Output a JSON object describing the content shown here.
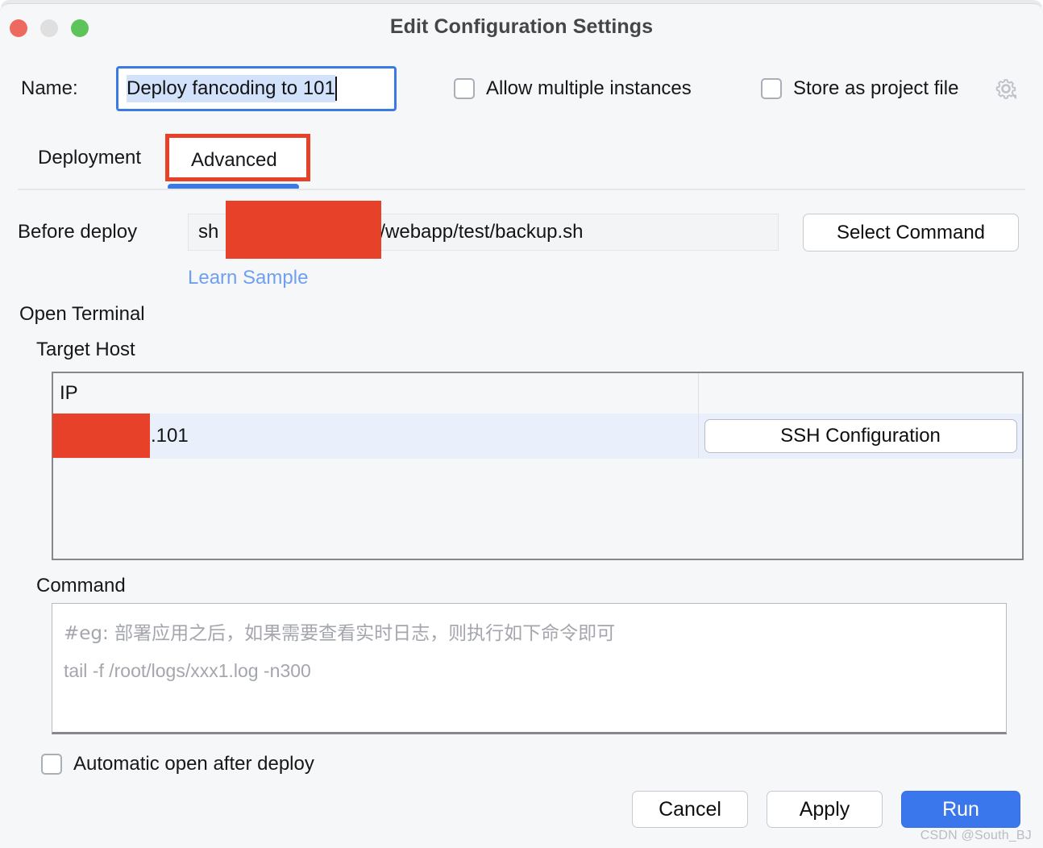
{
  "window": {
    "title": "Edit Configuration Settings",
    "traffic_lights": [
      "close-button",
      "minimize-button",
      "maximize-button"
    ]
  },
  "name_row": {
    "label": "Name:",
    "value": "Deploy fancoding to 101",
    "allow_multiple": {
      "label": "Allow multiple instances",
      "checked": false
    },
    "store_project_file": {
      "label": "Store as project file",
      "checked": false
    },
    "gear_icon": "gear-icon"
  },
  "tabs": [
    {
      "label": "Deployment",
      "active": false
    },
    {
      "label": "Advanced",
      "active": true
    }
  ],
  "before_deploy": {
    "label": "Before deploy",
    "value_prefix": "sh",
    "value_suffix": "/webapp/test/backup.sh",
    "redacted": true,
    "select_command_label": "Select Command",
    "learn_link": "Learn Sample"
  },
  "open_terminal": {
    "label": "Open Terminal",
    "target_host_label": "Target Host",
    "table": {
      "columns": [
        "IP",
        ""
      ],
      "rows": [
        {
          "ip": ".101",
          "ip_redacted": true,
          "action_label": "SSH Configuration",
          "selected": true
        }
      ]
    }
  },
  "command": {
    "label": "Command",
    "value": "",
    "placeholder_line1": "#eg: 部署应用之后，如果需要查看实时日志，则执行如下命令即可",
    "placeholder_line2": "tail -f /root/logs/xxx1.log -n300"
  },
  "automatic_open": {
    "label": "Automatic open after deploy",
    "checked": false
  },
  "footer": {
    "cancel_label": "Cancel",
    "apply_label": "Apply",
    "run_label": "Run",
    "watermark": "CSDN @South_BJ"
  },
  "colors": {
    "accent_blue": "#3b77ec",
    "annotation_red": "#e8412a",
    "link_blue": "#6f9ff0",
    "row_selected": "#e9effb"
  }
}
